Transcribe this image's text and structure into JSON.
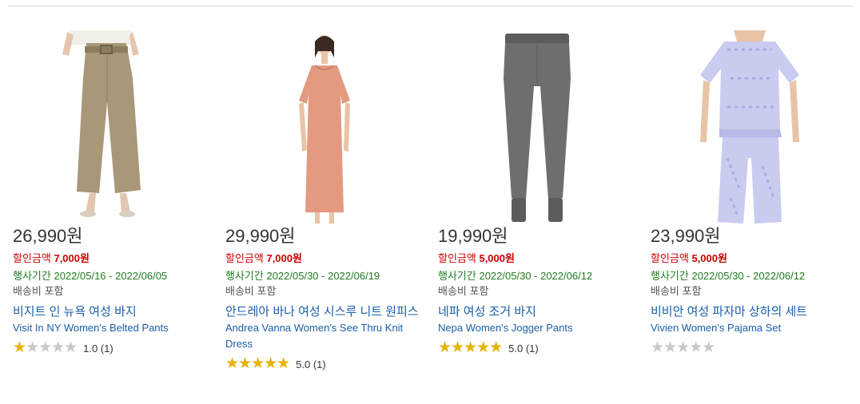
{
  "products": [
    {
      "price": "26,990원",
      "discount_label": "할인금액",
      "discount_amount": "7,000원",
      "promo_label": "행사기간",
      "promo_dates": "2022/05/16 - 2022/06/05",
      "shipping": "배송비 포함",
      "name_ko": "비지트 인 뉴욕 여성 바지",
      "name_en": "Visit In NY Women's Belted Pants",
      "rating": 1.0,
      "rating_text": "1.0 (1)"
    },
    {
      "price": "29,990원",
      "discount_label": "할인금액",
      "discount_amount": "7,000원",
      "promo_label": "행사기간",
      "promo_dates": "2022/05/30 - 2022/06/19",
      "shipping": "배송비 포함",
      "name_ko": "안드레아 바나 여성 시스루 니트 원피스",
      "name_en": "Andrea Vanna Women's See Thru Knit Dress",
      "rating": 5.0,
      "rating_text": "5.0 (1)"
    },
    {
      "price": "19,990원",
      "discount_label": "할인금액",
      "discount_amount": "5,000원",
      "promo_label": "행사기간",
      "promo_dates": "2022/05/30 - 2022/06/12",
      "shipping": "배송비 포함",
      "name_ko": "네파 여성 조거 바지",
      "name_en": "Nepa Women's Jogger Pants",
      "rating": 5.0,
      "rating_text": "5.0 (1)"
    },
    {
      "price": "23,990원",
      "discount_label": "할인금액",
      "discount_amount": "5,000원",
      "promo_label": "행사기간",
      "promo_dates": "2022/05/30 - 2022/06/12",
      "shipping": "배송비 포함",
      "name_ko": "비비안 여성 파자마 상하의 세트",
      "name_en": "Vivien Women's Pajama Set",
      "rating": 0,
      "rating_text": ""
    }
  ],
  "colors": {
    "discount": "#cc0000",
    "promo": "#1f7a1f",
    "link": "#1a5ea8",
    "star_filled": "#e6b400",
    "star_empty": "#c8c8c8"
  }
}
